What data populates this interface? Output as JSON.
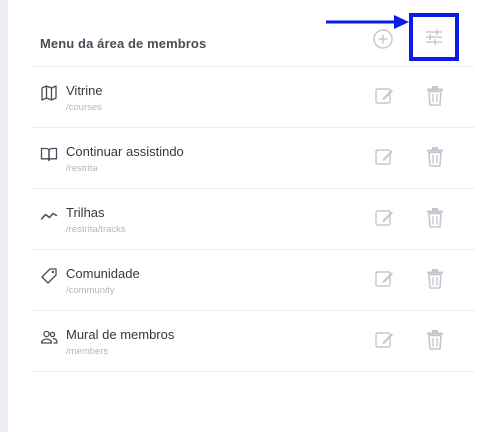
{
  "header": {
    "title": "Menu da área de membros",
    "add_icon": "plus-circle-icon",
    "filter_icon": "sliders-icon"
  },
  "colors": {
    "highlight": "#0a1de6",
    "icon_muted": "#c4c7cf",
    "text": "#363841",
    "subtext": "#b4b7c1"
  },
  "menu": {
    "items": [
      {
        "title": "Vitrine",
        "path": "/courses",
        "icon": "map-icon"
      },
      {
        "title": "Continuar assistindo",
        "path": "/restrita",
        "icon": "book-open-icon"
      },
      {
        "title": "Trilhas",
        "path": "/restrita/tracks",
        "icon": "trending-line-icon"
      },
      {
        "title": "Comunidade",
        "path": "/community",
        "icon": "tag-icon"
      },
      {
        "title": "Mural de membros",
        "path": "/members",
        "icon": "users-icon"
      }
    ]
  }
}
